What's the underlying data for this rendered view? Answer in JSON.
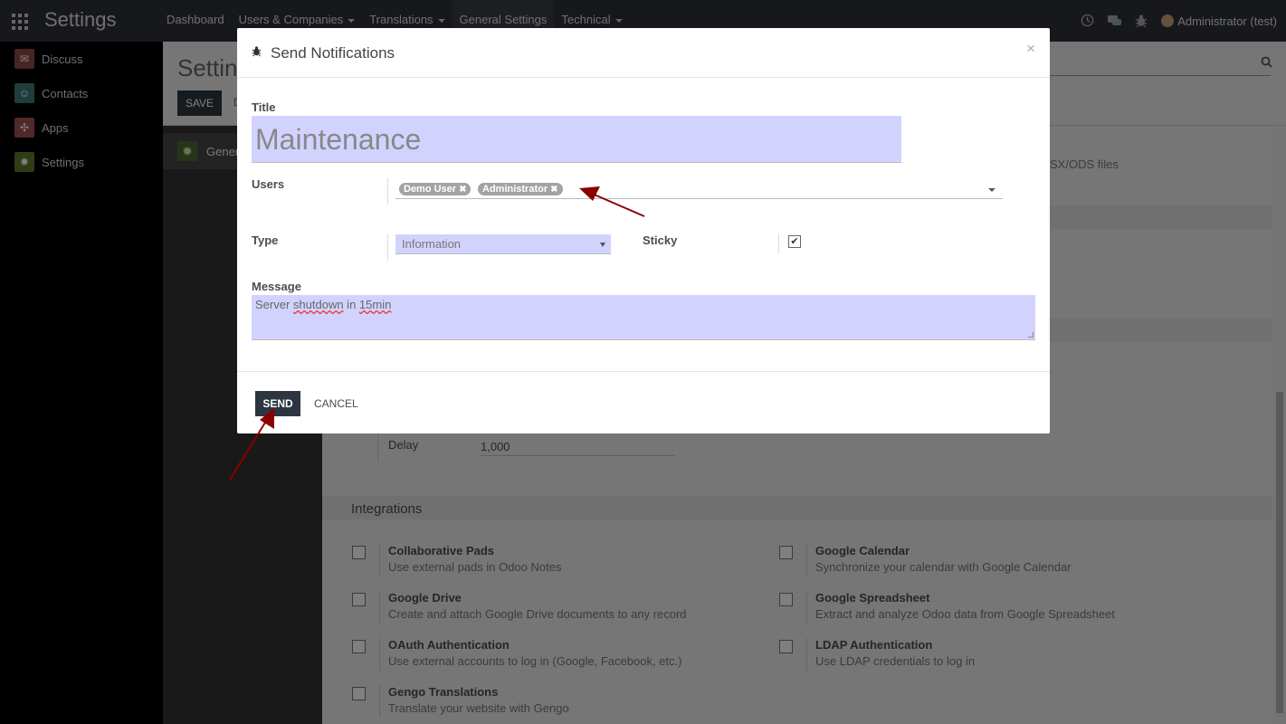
{
  "app": {
    "title": "Settings"
  },
  "topmenu": [
    {
      "label": "Dashboard",
      "dropdown": false
    },
    {
      "label": "Users & Companies",
      "dropdown": true
    },
    {
      "label": "Translations",
      "dropdown": true
    },
    {
      "label": "General Settings",
      "dropdown": false,
      "active": true
    },
    {
      "label": "Technical",
      "dropdown": true
    }
  ],
  "systray": {
    "icons": [
      "clock-icon",
      "chat-icon",
      "bug-icon"
    ],
    "user": "Administrator (test)"
  },
  "sidebar": {
    "items": [
      {
        "label": "Discuss",
        "icon": "discuss-icon",
        "color": "#8f4a4a"
      },
      {
        "label": "Contacts",
        "icon": "contacts-icon",
        "color": "#3e7a79"
      },
      {
        "label": "Apps",
        "icon": "apps-module-icon",
        "color": "#a15050"
      },
      {
        "label": "Settings",
        "icon": "settings-gear-icon",
        "color": "#5f7a2f"
      }
    ]
  },
  "background": {
    "page_title": "Settin",
    "save_label": "SAVE",
    "discard_label": "D",
    "left_item": "Gener",
    "xlsx_text": "SX/ODS files",
    "delay_label": "Delay",
    "delay_value": "1,000",
    "integrations_title": "Integrations",
    "features": [
      {
        "title": "Collaborative Pads",
        "desc": "Use external pads in Odoo Notes"
      },
      {
        "title": "Google Calendar",
        "desc": "Synchronize your calendar with Google Calendar"
      },
      {
        "title": "Google Drive",
        "desc": "Create and attach Google Drive documents to any record"
      },
      {
        "title": "Google Spreadsheet",
        "desc": "Extract and analyze Odoo data from Google Spreadsheet"
      },
      {
        "title": "OAuth Authentication",
        "desc": "Use external accounts to log in (Google, Facebook, etc.)"
      },
      {
        "title": "LDAP Authentication",
        "desc": "Use LDAP credentials to log in"
      },
      {
        "title": "Gengo Translations",
        "desc": "Translate your website with Gengo"
      }
    ]
  },
  "modal": {
    "title": "Send Notifications",
    "close": "×",
    "fields": {
      "title_label": "Title",
      "title_value": "Maintenance",
      "users_label": "Users",
      "users": [
        "Demo User",
        "Administrator"
      ],
      "type_label": "Type",
      "type_value": "Information",
      "sticky_label": "Sticky",
      "sticky_checked": true,
      "message_label": "Message",
      "message_parts": [
        "Server ",
        "shutdown",
        " in ",
        "15min"
      ]
    },
    "send_label": "SEND",
    "cancel_label": "CANCEL"
  },
  "colors": {
    "navbar": "#2f3136",
    "input_highlight": "#d2d2ff",
    "primary_button": "#2d3640",
    "annotation_arrow": "#8b0000"
  }
}
